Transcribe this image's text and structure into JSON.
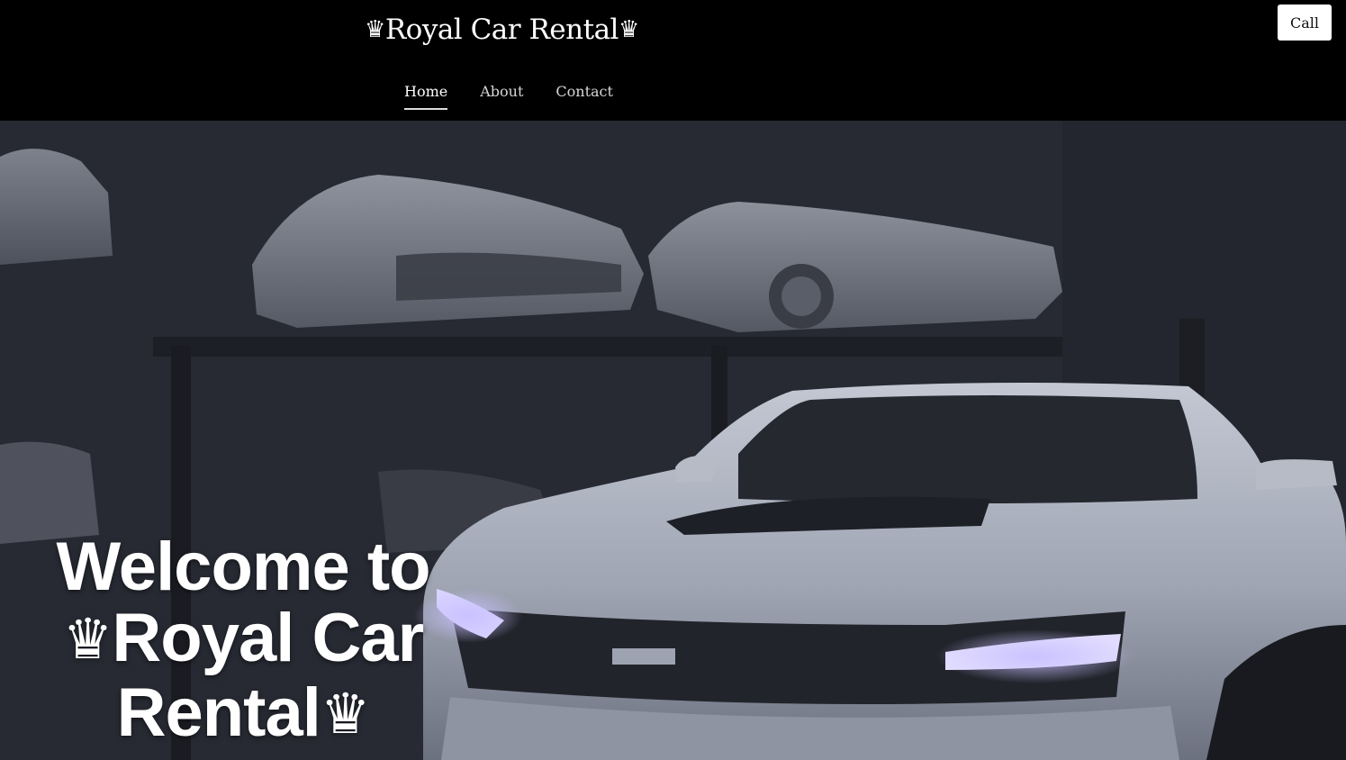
{
  "header": {
    "brand_crown_left": "♛",
    "brand_text": "Royal Car Rental",
    "brand_crown_right": "♛",
    "call_label": "Call"
  },
  "nav": {
    "items": [
      {
        "label": "Home",
        "active": true
      },
      {
        "label": "About",
        "active": false
      },
      {
        "label": "Contact",
        "active": false
      }
    ]
  },
  "hero": {
    "line1": "Welcome to",
    "crown_left": "♛",
    "line2_text": "Royal Car",
    "line3_text": "Rental",
    "crown_right": "♛",
    "image_subject": "sports-car-showroom-photo"
  },
  "colors": {
    "header_bg": "#000000",
    "hero_overlay": "#262932",
    "text": "#ffffff",
    "car_body": "#aab0bd"
  }
}
